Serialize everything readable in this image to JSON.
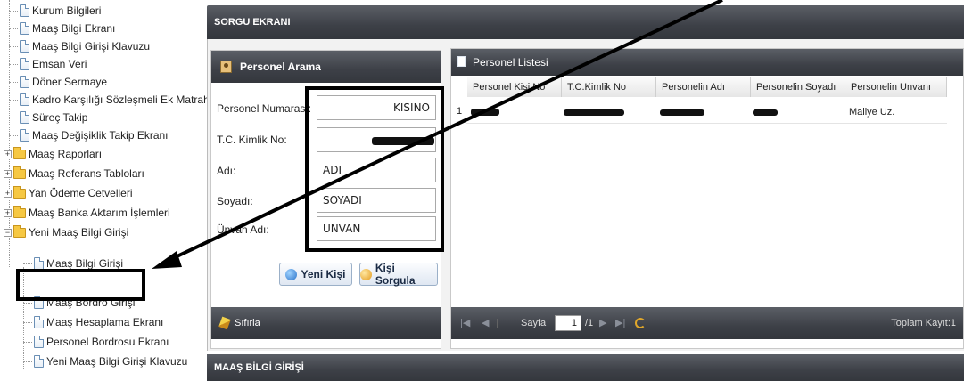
{
  "tree": {
    "items": [
      {
        "label": "Kurum Bilgileri",
        "type": "doc"
      },
      {
        "label": "Maaş Bilgi Ekranı",
        "type": "doc"
      },
      {
        "label": "Maaş Bilgi Girişi Klavuzu",
        "type": "doc"
      },
      {
        "label": "Emsan Veri",
        "type": "doc"
      },
      {
        "label": "Döner Sermaye",
        "type": "doc"
      },
      {
        "label": "Kadro Karşılığı Sözleşmeli Ek Matrah",
        "type": "doc"
      },
      {
        "label": "Süreç Takip",
        "type": "doc"
      },
      {
        "label": "Maaş Değişiklik Takip Ekranı",
        "type": "doc"
      },
      {
        "label": "Maaş Raporları",
        "type": "folder",
        "expander": "+"
      },
      {
        "label": "Maaş Referans Tabloları",
        "type": "folder",
        "expander": "+"
      },
      {
        "label": "Yan Ödeme Cetvelleri",
        "type": "folder",
        "expander": "+"
      },
      {
        "label": "Maaş Banka Aktarım İşlemleri",
        "type": "folder",
        "expander": "+"
      },
      {
        "label": "Yeni Maaş Bilgi Girişi",
        "type": "folder",
        "expander": "−"
      },
      {
        "label": "Maaş Bilgi Girişi",
        "type": "doc",
        "selected": true
      },
      {
        "label": "Maaş Bordro Girişi",
        "type": "doc"
      },
      {
        "label": "Maaş Hesaplama Ekranı",
        "type": "doc"
      },
      {
        "label": "Personel Bordrosu Ekranı",
        "type": "doc"
      },
      {
        "label": "Yeni Maaş Bilgi Girişi Klavuzu",
        "type": "doc"
      }
    ]
  },
  "sorgu": {
    "title": "SORGU EKRANI"
  },
  "arama": {
    "title": "Personel Arama",
    "fields": [
      {
        "label": "Personel Numarası:",
        "value": "KISINO"
      },
      {
        "label": "T.C. Kimlik No:",
        "value": ""
      },
      {
        "label": "Adı:",
        "value": "ADI"
      },
      {
        "label": "Soyadı:",
        "value": "SOYADI"
      },
      {
        "label": "Ünvan Adı:",
        "value": "UNVAN"
      }
    ],
    "yeni_kisi": "Yeni Kişi",
    "kisi_sorgula": "Kişi Sorgula",
    "sifirla": "Sıfırla"
  },
  "liste": {
    "title": "Personel Listesi",
    "columns": [
      "Personel Kişi No",
      "T.C.Kimlik No",
      "Personelin Adı",
      "Personelin Soyadı",
      "Personelin Unvanı"
    ],
    "rows": [
      {
        "num": "1",
        "unvan": "Maliye Uz."
      }
    ],
    "pager": {
      "sayfa_label": "Sayfa",
      "page": "1",
      "of": "/1",
      "toplam": "Toplam Kayıt:1"
    }
  },
  "maas": {
    "title": "MAAŞ BİLGİ GİRİŞİ"
  },
  "colors": {
    "header_dark": "#3d4047",
    "annotation": "#000000",
    "folder": "#f6c843"
  }
}
